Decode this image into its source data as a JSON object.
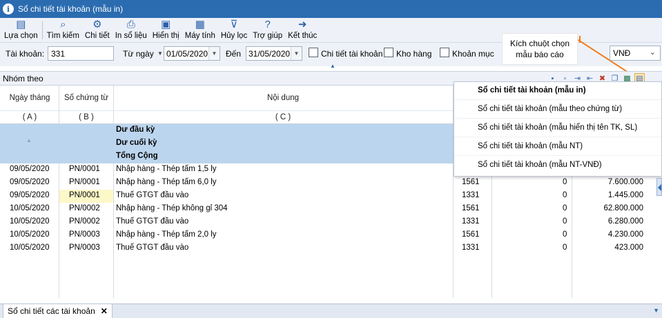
{
  "window": {
    "title": "Sổ chi tiết tài khoản (mẫu in)"
  },
  "toolbar": {
    "items": [
      {
        "label": "Lựa chọn",
        "icon": "select-icon"
      },
      {
        "label": "Tìm kiếm",
        "icon": "search-icon"
      },
      {
        "label": "Chi tiết",
        "icon": "detail-icon"
      },
      {
        "label": "In sổ liệu",
        "icon": "printer-icon"
      },
      {
        "label": "Hiển thị",
        "icon": "display-icon"
      },
      {
        "label": "Máy tính",
        "icon": "calculator-icon"
      },
      {
        "label": "Hủy lọc",
        "icon": "clear-filter-icon"
      },
      {
        "label": "Trợ giúp",
        "icon": "help-icon"
      },
      {
        "label": "Kết thúc",
        "icon": "exit-icon"
      }
    ]
  },
  "filters": {
    "account_label": "Tài khoản:",
    "account_value": "331",
    "from_label": "Từ ngày",
    "from_value": "01/05/2020",
    "to_label": "Đến",
    "to_value": "31/05/2020",
    "chk_detail": "Chi tiết tài khoản",
    "chk_warehouse": "Kho hàng",
    "chk_item": "Khoản mục",
    "currency": "VNĐ"
  },
  "callout": {
    "line1": "Kích chuột chọn",
    "line2": "mẫu báo cáo"
  },
  "group": {
    "label": "Nhóm theo"
  },
  "table": {
    "headers": {
      "date": "Ngày tháng",
      "voucher": "Số chứng từ",
      "content": "Nội dung"
    },
    "codes": {
      "date": "( A )",
      "voucher": "( B )",
      "content": "( C )"
    },
    "summary": {
      "opening": "Dư đầu kỳ",
      "closing": "Dư cuối kỳ",
      "total": "Tổng Cộng"
    },
    "rows": [
      {
        "date": "09/05/2020",
        "voucher": "PN/0001",
        "content": "Nhập hàng - Thép tấm 1,5 ly",
        "acct": "",
        "debit": "",
        "credit": ""
      },
      {
        "date": "09/05/2020",
        "voucher": "PN/0001",
        "content": "Nhập hàng - Thép tấm 6,0 ly",
        "acct": "1561",
        "debit": "0",
        "credit": "7.600.000"
      },
      {
        "date": "09/05/2020",
        "voucher": "PN/0001",
        "content": "Thuế GTGT đầu vào",
        "acct": "1331",
        "debit": "0",
        "credit": "1.445.000"
      },
      {
        "date": "10/05/2020",
        "voucher": "PN/0002",
        "content": "Nhập hàng - Thép không gỉ 304",
        "acct": "1561",
        "debit": "0",
        "credit": "62.800.000"
      },
      {
        "date": "10/05/2020",
        "voucher": "PN/0002",
        "content": "Thuế GTGT đầu vào",
        "acct": "1331",
        "debit": "0",
        "credit": "6.280.000"
      },
      {
        "date": "10/05/2020",
        "voucher": "PN/0003",
        "content": "Nhập hàng - Thép tấm 2,0 ly",
        "acct": "1561",
        "debit": "0",
        "credit": "4.230.000"
      },
      {
        "date": "10/05/2020",
        "voucher": "PN/0003",
        "content": "Thuế GTGT đầu vào",
        "acct": "1331",
        "debit": "0",
        "credit": "423.000"
      }
    ]
  },
  "dropdown": {
    "items": [
      "Sổ chi tiết tài khoản (mẫu in)",
      "Sổ chi tiết tài khoản (mẫu theo chứng từ)",
      "Sổ chi tiết tài khoản (mẫu hiển thị tên TK, SL)",
      "Sổ chi tiết tài khoản (mẫu NT)",
      "Sổ chi tiết tài khoản (mẫu NT-VNĐ)"
    ]
  },
  "tabs": {
    "active": "Sổ chi tiết các tài khoản",
    "close": "✕"
  },
  "colors": {
    "title_bar": "#2b6cb0",
    "summary_row": "#bcd5ee",
    "callout_line": "#f07b1d"
  }
}
